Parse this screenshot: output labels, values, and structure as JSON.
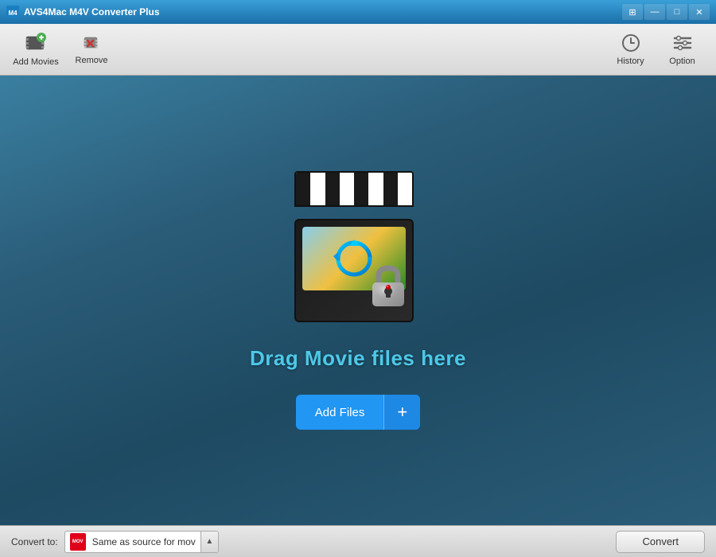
{
  "titleBar": {
    "appName": "AVS4Mac M4V Converter Plus",
    "controls": {
      "minimize": "—",
      "maximize": "□",
      "close": "✕",
      "sysMenu": "⊞"
    }
  },
  "toolbar": {
    "addMovies": {
      "label": "Add Movies"
    },
    "remove": {
      "label": "Remove"
    },
    "history": {
      "label": "History"
    },
    "option": {
      "label": "Option"
    }
  },
  "main": {
    "dragText": "Drag Movie files here",
    "addFilesButton": "Add Files"
  },
  "bottomBar": {
    "convertToLabel": "Convert to:",
    "formatText": "Same as source for mov",
    "formatIconLabel": "MOV",
    "convertButton": "Convert"
  }
}
